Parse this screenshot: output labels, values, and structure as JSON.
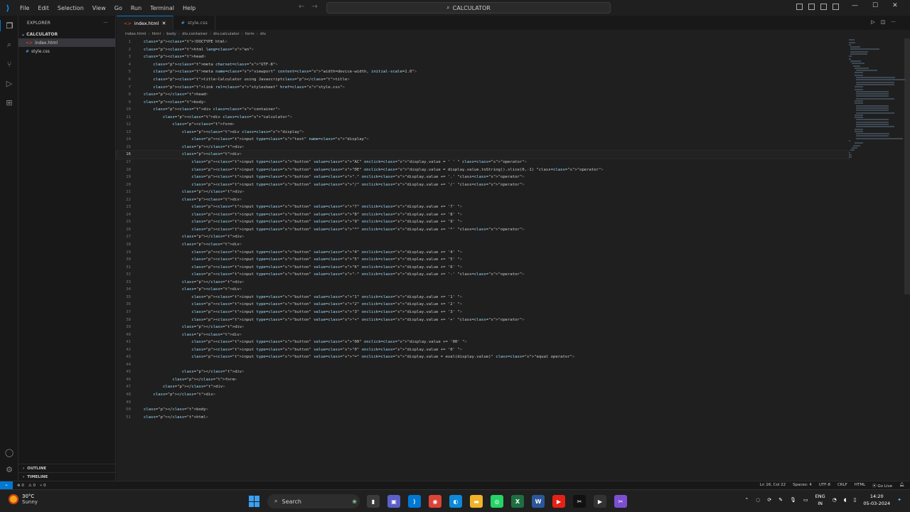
{
  "titlebar": {
    "menu": [
      "File",
      "Edit",
      "Selection",
      "View",
      "Go",
      "Run",
      "Terminal",
      "Help"
    ],
    "search": "CALCULATOR",
    "window_min": "—",
    "window_max": "☐",
    "window_close": "✕"
  },
  "sidebar": {
    "title": "EXPLORER",
    "more": "···",
    "folder": "CALCULATOR",
    "files": [
      {
        "name": "index.html",
        "icon": "html-file-icon",
        "selected": true
      },
      {
        "name": "style.css",
        "icon": "css-file-icon",
        "selected": false
      }
    ],
    "outline": "OUTLINE",
    "timeline": "TIMELINE"
  },
  "tabs": [
    {
      "label": "index.html",
      "active": true
    },
    {
      "label": "style.css",
      "active": false
    }
  ],
  "breadcrumb": [
    "index.html",
    "html",
    "body",
    "div.container",
    "div.calculator",
    "form",
    "div"
  ],
  "code_lines": [
    "<!DOCTYPE html>",
    "<html lang=\"en\">",
    "<head>",
    "    <meta charset=\"UTF-8\">",
    "    <meta name=\"viewport\" content=\"width=device-width, initial-scale=1.0\">",
    "    <title>Calculator using Javascript</title>",
    "    <link rel=\"stylesheet\" href=\"style.css\">",
    "</head>",
    "<body>",
    "    <div class=\"container\">",
    "        <div class=\"calculator\">",
    "            <form>",
    "                <div class=\"display\">",
    "                    <input type=\"text\" name=\"display\">",
    "                </div>",
    "                <div>",
    "                    <input type=\"button\" value=\"AC\" onclick=\"display.value = ' ' \" class=\"operator\">",
    "                    <input type=\"button\" value=\"DE\" onclick=\"display.value = display.value.toString().slice(0,-1) \"class=\"operator\">",
    "                    <input type=\"button\" value=\".\" onclick=\"display.value += '.' \"class=\"operator\">",
    "                    <input type=\"button\" value=\"/\" onclick=\"display.value += '/' \"class=\"operator\">",
    "                </div>",
    "                <div>",
    "                    <input type=\"button\" value=\"7\" onclick=\"display.value += '7' \">",
    "                    <input type=\"button\" value=\"8\" onclick=\"display.value += '8' \">",
    "                    <input type=\"button\" value=\"9\" onclick=\"display.value += '9' \">",
    "                    <input type=\"button\" value=\"*\" onclick=\"display.value += '*' \"class=\"operator\">",
    "                </div>",
    "                <div>",
    "                    <input type=\"button\" value=\"4\" onclick=\"display.value += '4' \">",
    "                    <input type=\"button\" value=\"5\" onclick=\"display.value += '5' \">",
    "                    <input type=\"button\" value=\"6\" onclick=\"display.value += '6' \">",
    "                    <input type=\"button\" value=\"-\" onclick=\"display.value += '-' \"class=\"operator\">",
    "                </div>",
    "                <div>",
    "                    <input type=\"button\" value=\"1\" onclick=\"display.value += '1' \">",
    "                    <input type=\"button\" value=\"2\" onclick=\"display.value += '2' \">",
    "                    <input type=\"button\" value=\"3\" onclick=\"display.value += '3' \">",
    "                    <input type=\"button\" value=\"+\" onclick=\"display.value += '+' \"class=\"operator\">",
    "                </div>",
    "                <div>",
    "                    <input type=\"button\" value=\"00\" onclick=\"display.value += '00' \">",
    "                    <input type=\"button\" value=\"0\" onclick=\"display.value += '0' \">",
    "                    <input type=\"button\" value=\"=\" onclick=\"display.value = eval(display.value)\" class=\"equal operator\">",
    "",
    "                </div>",
    "            </form>",
    "        </div>",
    "    </div>",
    "",
    "</body>",
    "</html>"
  ],
  "current_line": 16,
  "statusbar": {
    "errors": "⊗ 0",
    "warnings": "⚠ 0",
    "ports": "⑂ 0",
    "position": "Ln 16, Col 22",
    "spaces": "Spaces: 4",
    "encoding": "UTF-8",
    "eol": "CRLF",
    "language": "HTML",
    "golive": "Go Live"
  },
  "taskbar": {
    "temperature": "30°C",
    "weather": "Sunny",
    "search": "Search",
    "lang_top": "ENG",
    "lang_bottom": "IN",
    "time": "14:20",
    "date": "05-03-2024",
    "apps": [
      {
        "name": "files-app-icon",
        "glyph": "▮",
        "color": "#3b3b3b"
      },
      {
        "name": "teams-app-icon",
        "glyph": "▣",
        "color": "#5b5fc7"
      },
      {
        "name": "vscode-app-icon",
        "glyph": "⟩",
        "color": "#0078d4"
      },
      {
        "name": "chrome-app-icon",
        "glyph": "◉",
        "color": "#db4437"
      },
      {
        "name": "edge-app-icon",
        "glyph": "◐",
        "color": "#0c8ad9"
      },
      {
        "name": "file-explorer-icon",
        "glyph": "▬",
        "color": "#f0b429"
      },
      {
        "name": "whatsapp-app-icon",
        "glyph": "◎",
        "color": "#25d366"
      },
      {
        "name": "excel-app-icon",
        "glyph": "X",
        "color": "#1d6f42"
      },
      {
        "name": "word-app-icon",
        "glyph": "W",
        "color": "#2b579a"
      },
      {
        "name": "youtube-app-icon",
        "glyph": "▶",
        "color": "#e62117"
      },
      {
        "name": "capcut-app-icon",
        "glyph": "✂",
        "color": "#111111"
      },
      {
        "name": "media-app-icon",
        "glyph": "▶",
        "color": "#333333"
      },
      {
        "name": "snipping-tool-icon",
        "glyph": "✂",
        "color": "#7b4fd0"
      }
    ]
  }
}
